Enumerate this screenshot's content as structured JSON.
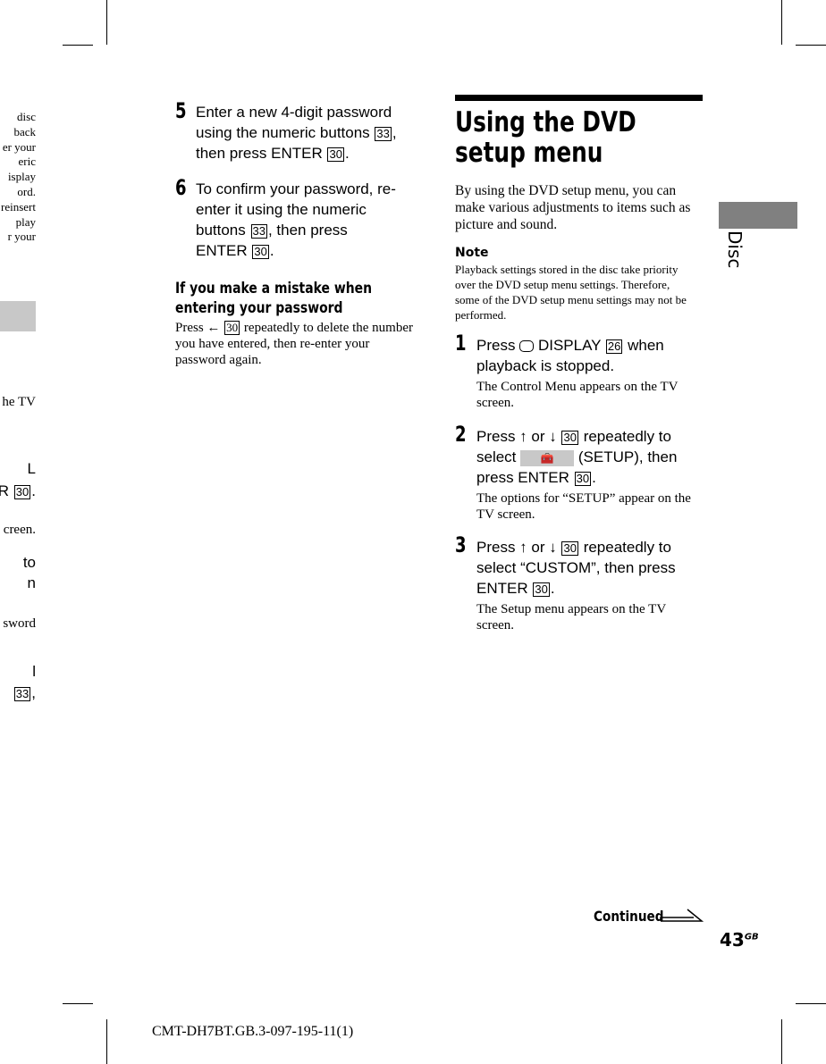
{
  "left_fragments": [
    "disc",
    "back",
    "er your",
    "eric",
    "isplay",
    "ord.",
    "reinsert",
    "play",
    "r your",
    "he TV",
    "L",
    "ER",
    "creen.",
    "to",
    "n",
    "sword",
    "l"
  ],
  "left_boxes": [
    "30",
    "33"
  ],
  "middle": {
    "step5": {
      "num": "5",
      "text_a": "Enter a new 4-digit password using the numeric buttons",
      "box_a": "33",
      "text_b": ", then press ENTER",
      "box_b": "30",
      "end": "."
    },
    "step6": {
      "num": "6",
      "text_a": "To confirm your password, re-enter it using the numeric buttons",
      "box_a": "33",
      "text_b": ", then press ENTER",
      "box_b": "30",
      "end": "."
    },
    "mistake_heading": "If you make a mistake when entering your password",
    "mistake_a": "Press",
    "mistake_arrow": "←",
    "mistake_box": "30",
    "mistake_b": "repeatedly to delete the number you have entered, then re-enter your password again."
  },
  "right": {
    "title": "Using the DVD setup menu",
    "intro": "By using the DVD setup menu, you can make various adjustments to items such as picture and sound.",
    "note_label": "Note",
    "note": "Playback settings stored in the disc take priority over the DVD setup menu settings. Therefore, some of the DVD setup menu settings may not be performed.",
    "step1": {
      "num": "1",
      "a": "Press",
      "icon": "display-icon",
      "b": "DISPLAY",
      "box": "26",
      "c": "when playback is stopped.",
      "desc": "The Control Menu appears on the TV screen."
    },
    "step2": {
      "num": "2",
      "a": "Press ↑ or ↓",
      "box": "30",
      "b": "repeatedly to select",
      "setup_icon": "toolbox-icon",
      "c": "(SETUP), then press ENTER",
      "box2": "30",
      "end": ".",
      "desc": "The options for “SETUP” appear on the TV screen."
    },
    "step3": {
      "num": "3",
      "a": "Press ↑ or ↓",
      "box": "30",
      "b": "repeatedly to select “CUSTOM”, then press ENTER",
      "box2": "30",
      "end": ".",
      "desc": "The Setup menu appears on the TV screen."
    }
  },
  "side_tab": "Disc",
  "continued": "Continued",
  "page_number": "43",
  "page_suffix": "GB",
  "footer": "CMT-DH7BT.GB.3-097-195-11(1)"
}
